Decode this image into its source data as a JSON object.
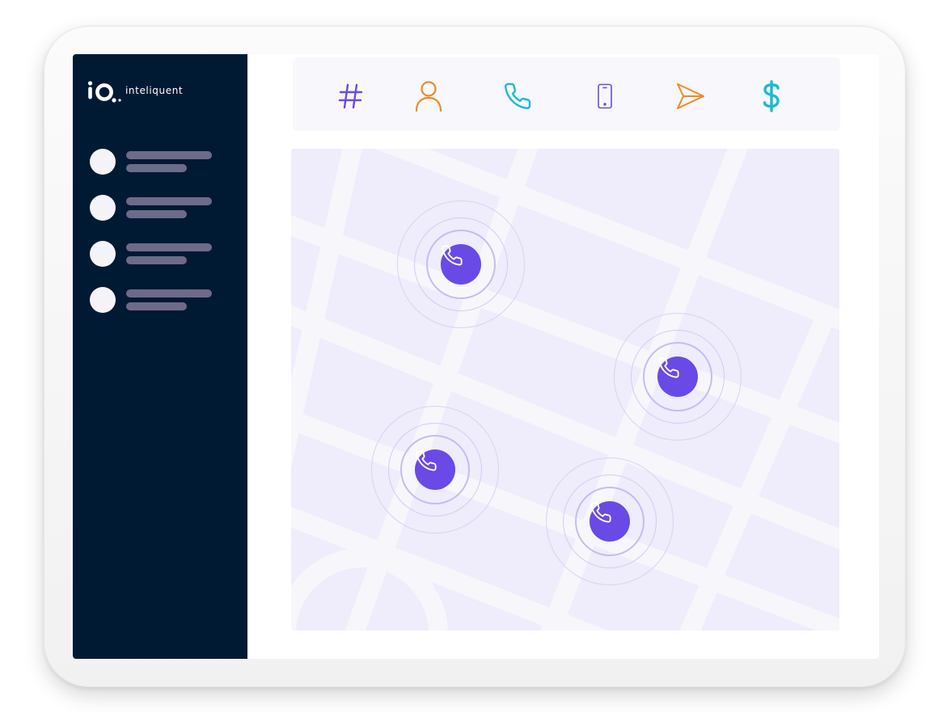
{
  "brand": {
    "name": "inteliquent",
    "mark": "iQ"
  },
  "sidebar": {
    "items": [
      {
        "id": "item-1",
        "avatar": "placeholder-avatar"
      },
      {
        "id": "item-2",
        "avatar": "placeholder-avatar"
      },
      {
        "id": "item-3",
        "avatar": "placeholder-avatar"
      },
      {
        "id": "item-4",
        "avatar": "placeholder-avatar"
      }
    ]
  },
  "toolbar": {
    "tools": [
      {
        "icon": "hash-icon",
        "color": "#6a4ae6"
      },
      {
        "icon": "user-icon",
        "color": "#f08a24"
      },
      {
        "icon": "phone-icon",
        "color": "#19bcd1"
      },
      {
        "icon": "mobile-icon",
        "color": "#6a4ae6"
      },
      {
        "icon": "send-icon",
        "color": "#f08a24"
      },
      {
        "icon": "dollar-icon",
        "color": "#19bcd1"
      }
    ]
  },
  "map": {
    "background_color": "#efecfb",
    "road_color": "#f7f6fa",
    "pins": [
      {
        "icon": "phone-icon",
        "color": "#6a4ae6"
      },
      {
        "icon": "phone-icon",
        "color": "#6a4ae6"
      },
      {
        "icon": "phone-icon",
        "color": "#6a4ae6"
      },
      {
        "icon": "phone-icon",
        "color": "#6a4ae6"
      }
    ]
  },
  "colors": {
    "sidebar": "#001a33",
    "accent": "#6a4ae6",
    "orange": "#f08a24",
    "teal": "#19bcd1"
  }
}
